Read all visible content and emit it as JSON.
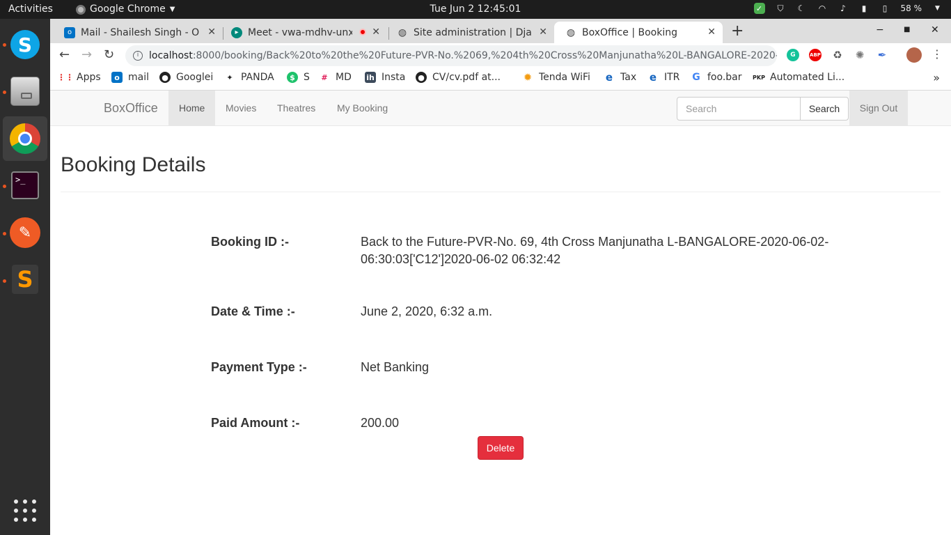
{
  "system": {
    "activities": "Activities",
    "app_name": "Google Chrome",
    "clock": "Tue Jun 2  12:45:01",
    "battery": "58 %"
  },
  "dock": {
    "items": [
      "skype",
      "files",
      "google-chrome",
      "terminal",
      "postman",
      "sublime-text",
      "show-applications"
    ]
  },
  "browser": {
    "tabs": [
      {
        "title": "Mail - Shailesh Singh - Out",
        "favicon": "outlook-icon"
      },
      {
        "title": "Meet - vwa-mdhv-unx",
        "favicon": "meet-icon"
      },
      {
        "title": "Site administration | Djan",
        "favicon": "globe-icon"
      },
      {
        "title": "BoxOffice | Booking",
        "favicon": "globe-icon"
      }
    ],
    "url_host": "localhost",
    "url_rest": ":8000/booking/Back%20to%20the%20Future-PVR-No.%2069,%204th%20Cross%20Manjunatha%20L-BANGALORE-2020-06-...",
    "bookmarks": [
      "Apps",
      "mail",
      "Googlei",
      "PANDA",
      "S",
      "MD",
      "Insta",
      "CV/cv.pdf at...",
      "Tenda WiFi",
      "Tax",
      "ITR",
      "foo.bar",
      "Automated Li..."
    ]
  },
  "nav": {
    "brand": "BoxOffice",
    "links": [
      "Home",
      "Movies",
      "Theatres",
      "My Booking"
    ],
    "search_placeholder": "Search",
    "search_button": "Search",
    "signout": "Sign Out"
  },
  "booking": {
    "title": "Booking Details",
    "id_label": "Booking ID :-",
    "id_value": "Back to the Future-PVR-No. 69, 4th Cross Manjunatha L-BANGALORE-2020-06-02-06:30:03['C12']2020-06-02 06:32:42",
    "date_label": "Date & Time :-",
    "date_value": "June 2, 2020, 6:32 a.m.",
    "payment_label": "Payment Type :-",
    "payment_value": "Net Banking",
    "amount_label": "Paid Amount :-",
    "amount_value": "200.00",
    "delete_button": "Delete"
  },
  "colors": {
    "delete": "#e52f3d",
    "navbar_bg": "#f8f8f8",
    "dock_bg": "#2d2d2d",
    "topbar_bg": "#1d1d1d"
  }
}
